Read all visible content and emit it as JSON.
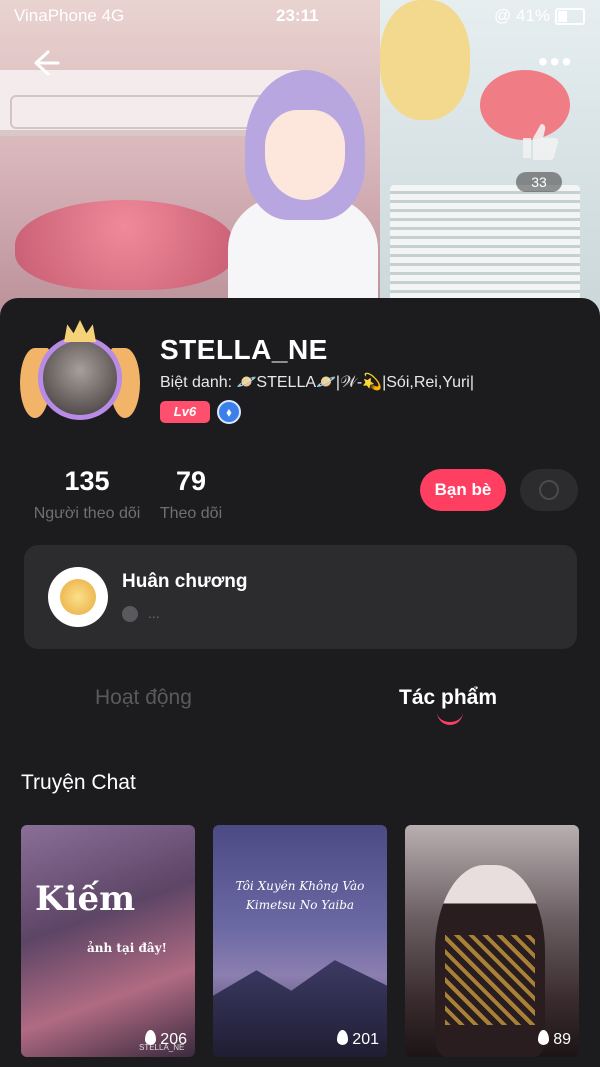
{
  "status_bar": {
    "carrier": "VinaPhone  4G",
    "time": "23:11",
    "battery": "41%",
    "battery_level": 0.41
  },
  "header": {
    "back_icon": "back-arrow-icon",
    "more_icon": "more-dots-icon",
    "like_count": "33"
  },
  "profile": {
    "username": "STELLA_NE",
    "nickname": "Biệt danh: 🪐STELLA🪐|𝒲-💫|Sói,Rei,Yuri|",
    "level": "Lv6",
    "badge_icon": "verified-badge-icon"
  },
  "stats": [
    {
      "value": "135",
      "label": "Người theo dõi"
    },
    {
      "value": "79",
      "label": "Theo dõi"
    }
  ],
  "actions": {
    "friends_label": "Bạn bè",
    "chat_icon": "chat-bubble-icon"
  },
  "medal": {
    "title": "Huân chương",
    "subtitle": "..."
  },
  "tabs": [
    {
      "label": "Hoạt động",
      "active": false
    },
    {
      "label": "Tác phẩm",
      "active": true
    }
  ],
  "section": {
    "title": "Truyện Chat"
  },
  "stories": [
    {
      "cover_text": "Kiếm",
      "cover_subtext": "ảnh tại đây!",
      "watermark": "STELLA_NE",
      "count": "206"
    },
    {
      "cover_text": "Tôi Xuyên Không Vào Kimetsu No Yaiba",
      "count": "201"
    },
    {
      "count": "89"
    }
  ],
  "colors": {
    "accent": "#ff3f62",
    "background": "#1c1c1e",
    "card": "#2c2c2e"
  }
}
